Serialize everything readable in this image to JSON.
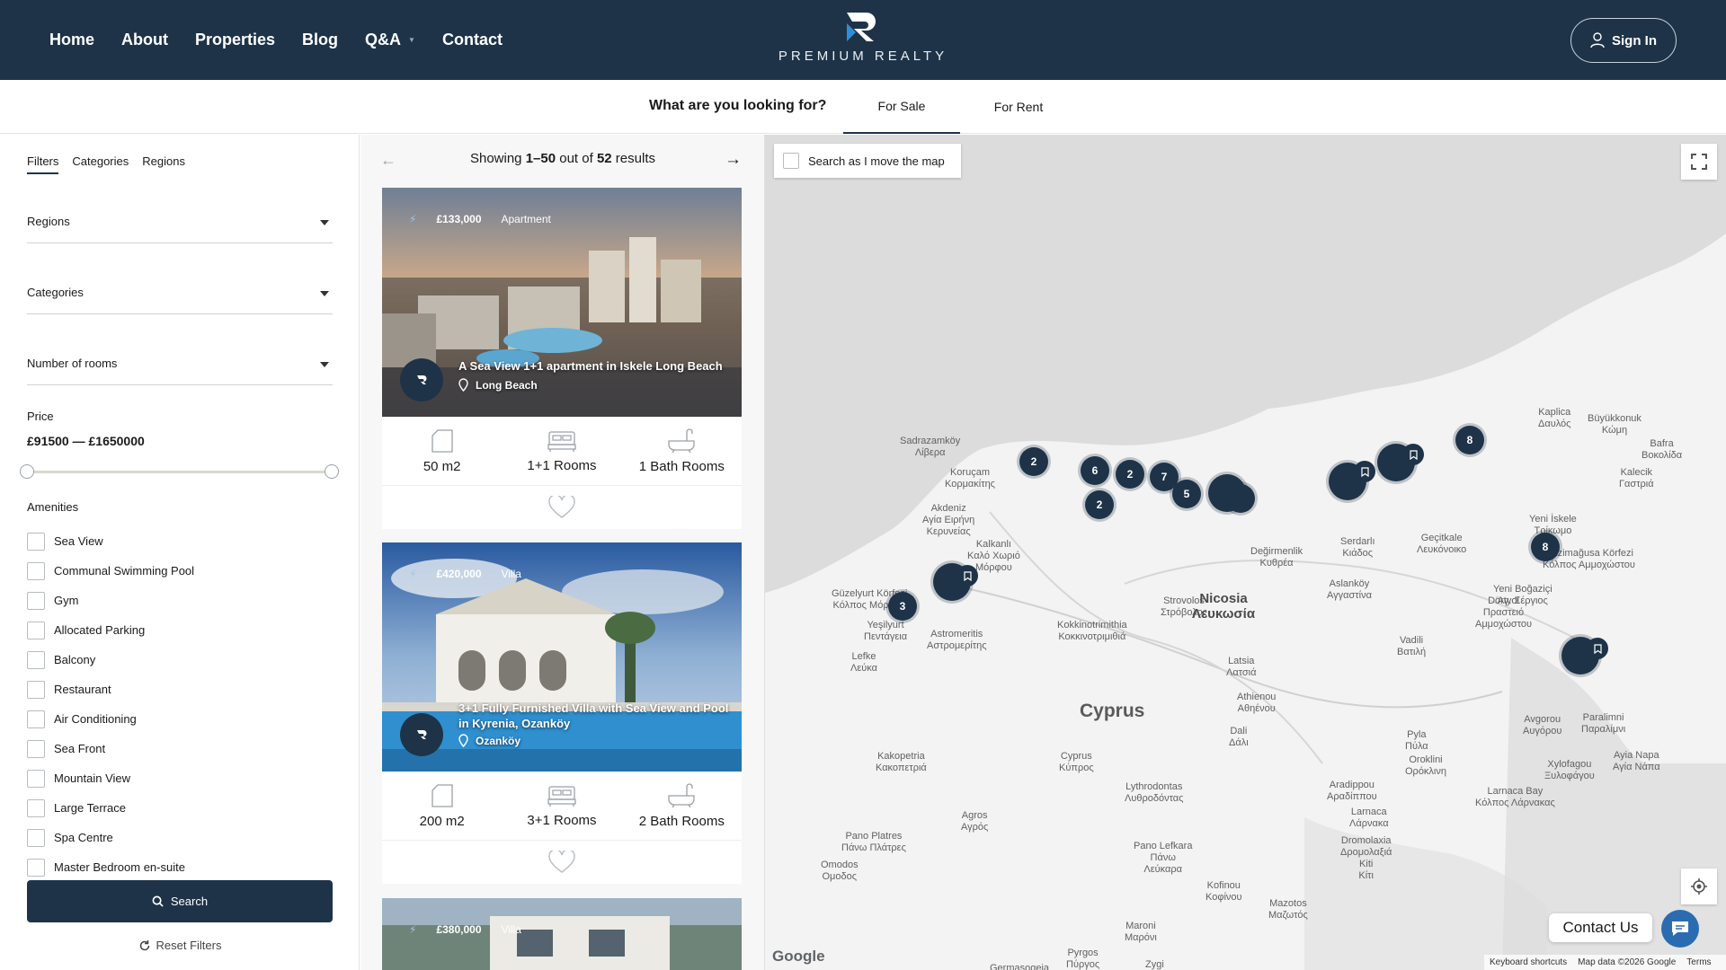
{
  "header": {
    "nav": [
      {
        "label": "Home"
      },
      {
        "label": "About"
      },
      {
        "label": "Properties"
      },
      {
        "label": "Blog"
      },
      {
        "label": "Q&A"
      },
      {
        "label": "Contact"
      }
    ],
    "logo_text": "PREMIUM REALTY",
    "signin_label": "Sign In"
  },
  "subnav": {
    "question": "What are you looking for?",
    "tabs": [
      {
        "label": "For Sale"
      },
      {
        "label": "For Rent"
      }
    ]
  },
  "filters": {
    "tabs": [
      {
        "label": "Filters"
      },
      {
        "label": "Categories"
      },
      {
        "label": "Regions"
      }
    ],
    "dropdowns": [
      {
        "label": "Regions"
      },
      {
        "label": "Categories"
      },
      {
        "label": "Number of rooms"
      }
    ],
    "price_label": "Price",
    "price_value": "£91500 — £1650000",
    "amenities_label": "Amenities",
    "amenities": [
      "Sea View",
      "Communal Swimming Pool",
      "Gym",
      "Allocated Parking",
      "Balcony",
      "Restaurant",
      "Air Conditioning",
      "Sea Front",
      "Mountain View",
      "Large Terrace",
      "Spa Centre",
      "Master Bedroom en-suite"
    ],
    "search_label": "Search",
    "reset_label": "Reset Filters"
  },
  "results": {
    "prefix": "Showing ",
    "range": "1–50",
    "middle": " out of ",
    "total": "52",
    "suffix": " results"
  },
  "listings": [
    {
      "price": "£133,000",
      "type": "Apartment",
      "title": "A Sea View 1+1 apartment in Iskele Long Beach",
      "location": "Long Beach",
      "area": "50 m2",
      "rooms": "1+1 Rooms",
      "baths": "1 Bath Rooms"
    },
    {
      "price": "£420,000",
      "type": "Villa",
      "title": "3+1 Fully Furnished Villa with Sea View and Pool in Kyrenia, Ozanköy",
      "location": "Ozanköy",
      "area": "200 m2",
      "rooms": "3+1 Rooms",
      "baths": "2 Bath Rooms"
    },
    {
      "price": "£380,000",
      "type": "Villa"
    }
  ],
  "map": {
    "search_move_label": "Search as I move the map",
    "labels": [
      {
        "text": "Sadrazamköy\nΛίβερα"
      },
      {
        "text": "Koruçam\nΚορμακίτης"
      },
      {
        "text": "Akdeniz\nΑγία Ειρήνη\nΚερυνείας"
      },
      {
        "text": "Kalkanlı\nΚαλό Χωριό\nΜόρφου"
      },
      {
        "text": "Güzelyurt Körfezi\nΚόλπος Μόρφου"
      },
      {
        "text": "Yeşilyurt\nΠεντάγεια"
      },
      {
        "text": "Lefke\nΛεύκα"
      },
      {
        "text": "Astromeritis\nΑστρομερίτης"
      },
      {
        "text": "Kokkinotrimithia\nΚοκκινοτριμιθιά"
      },
      {
        "text": "Strovolos\nΣτρόβολος"
      },
      {
        "text": "Latsia\nΛατσιά"
      },
      {
        "text": "Değirmenlik\nΚυθρέα"
      },
      {
        "text": "Aslanköy\nΑγγαστίνα"
      },
      {
        "text": "Serdarlı\nΚιάδος"
      },
      {
        "text": "Geçitkale\nΛευκόνοικο"
      },
      {
        "text": "Dörtyol\nΠραστειό\nΑμμοχώστου"
      },
      {
        "text": "Vadili\nΒατιλή"
      },
      {
        "text": "Yeni İskele\nΤρίκωμο"
      },
      {
        "text": "Gazimağusa Körfezi\nΚόλπος Αμμοχώστου"
      },
      {
        "text": "Yeni Boğaziçi\nΑγ. Σέργιος"
      },
      {
        "text": "Kaplica\nΔαυλός"
      },
      {
        "text": "Büyükkonuk\nΚώμη"
      },
      {
        "text": "Bafra\nΒοκολίδα"
      },
      {
        "text": "Kalecik\nΓαστριά"
      },
      {
        "text": "Athienou\nΑθηένου"
      },
      {
        "text": "Avgorou\nΑυγόρου"
      },
      {
        "text": "Paralimni\nΠαραλίμνι"
      },
      {
        "text": "Pyla\nΠύλα"
      },
      {
        "text": "Dali\nΔάλι"
      },
      {
        "text": "Kakopetria\nΚακοπετριά"
      },
      {
        "text": "Cyprus\nΚύπρος"
      },
      {
        "text": "Lythrodontas\nΛυθροδόντας"
      },
      {
        "text": "Agros\nΑγρός"
      },
      {
        "text": "Pano Platres\nΠάνω Πλάτρες"
      },
      {
        "text": "Omodos\nΟμοδος"
      },
      {
        "text": "Pano Lefkara\nΠάνω\nΛεύκαρα"
      },
      {
        "text": "Oroklini\nΟρόκλινη"
      },
      {
        "text": "Aradippou\nΑραδίππου"
      },
      {
        "text": "Larnaca\nΛάρνακα"
      },
      {
        "text": "Larnaca Bay\nΚόλπος Λάρνακας"
      },
      {
        "text": "Xylofagou\nΞυλοφάγου"
      },
      {
        "text": "Ayia Napa\nΑγία Νάπα"
      },
      {
        "text": "Dromolaxia\nΔρομολαξιά\nKiti\nΚίτι"
      },
      {
        "text": "Kofinou\nΚοφίνου"
      },
      {
        "text": "Mazotos\nΜαζωτός"
      },
      {
        "text": "Maroni\nΜαρόνι"
      },
      {
        "text": "Pyrgos\nΠύργος"
      },
      {
        "text": "Zygi"
      },
      {
        "text": "Germasogeia"
      }
    ],
    "city": "Nicosia\nΛευκωσία",
    "country": "Cyprus",
    "clusters": [
      "2",
      "6",
      "2",
      "7",
      "5",
      "2",
      "2",
      "3",
      "8",
      "8"
    ],
    "footer": [
      "Keyboard shortcuts",
      "Map data ©2026 Google",
      "Terms"
    ],
    "google": "Google"
  },
  "contact_label": "Contact Us"
}
